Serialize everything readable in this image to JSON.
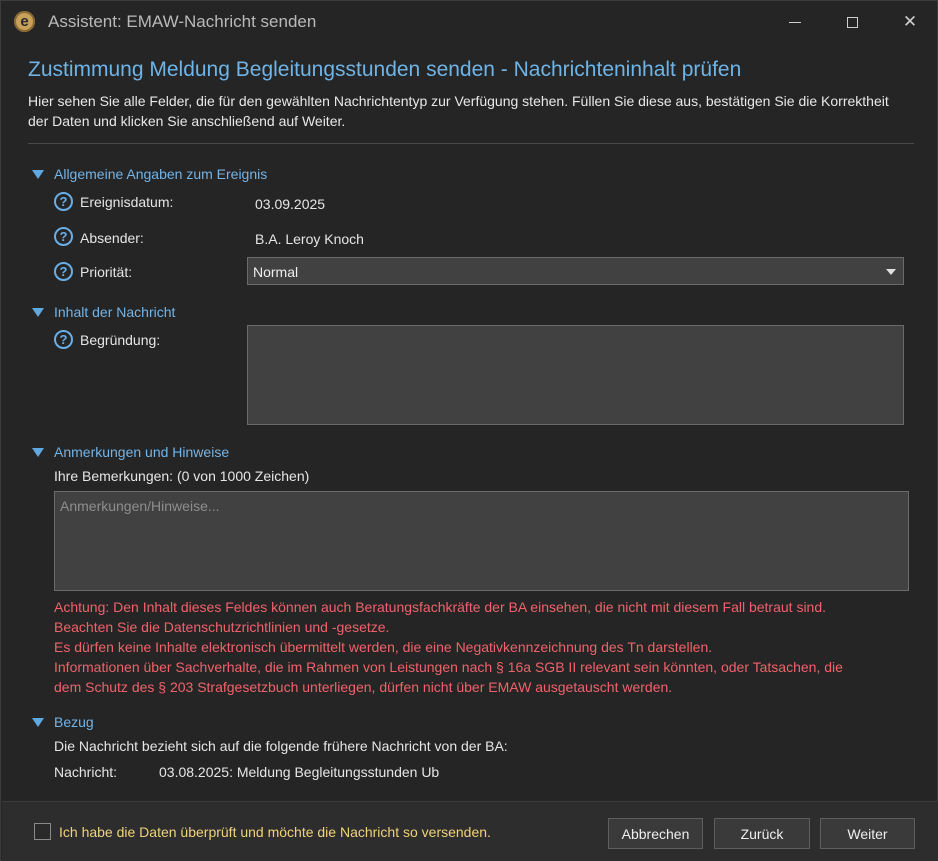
{
  "window": {
    "app_icon_letter": "e",
    "title": "Assistent: EMAW-Nachricht senden",
    "controls": {
      "minimize": "minimize",
      "maximize": "maximize",
      "close": "✕"
    }
  },
  "heading": "Zustimmung Meldung Begleitungsstunden senden - Nachrichteninhalt prüfen",
  "intro": "Hier sehen Sie alle Felder, die für den gewählten Nachrichtentyp zur Verfügung stehen. Füllen Sie diese aus, bestätigen Sie die Korrektheit der Daten und klicken Sie anschließend auf Weiter.",
  "sections": {
    "general": {
      "label": "Allgemeine Angaben zum Ereignis",
      "fields": {
        "date": {
          "label": "Ereignisdatum:",
          "value": "03.09.2025"
        },
        "sender": {
          "label": "Absender:",
          "value": "B.A. Leroy Knoch"
        },
        "priority": {
          "label": "Priorität:",
          "value": "Normal"
        }
      }
    },
    "content": {
      "label": "Inhalt der Nachricht",
      "fields": {
        "reason": {
          "label": "Begründung:",
          "value": ""
        }
      }
    },
    "notes": {
      "label": "Anmerkungen und Hinweise",
      "remarks_label": "Ihre Bemerkungen: (0 von 1000 Zeichen)",
      "placeholder": "Anmerkungen/Hinweise...",
      "warnings": [
        "Achtung: Den Inhalt dieses Feldes können auch Beratungsfachkräfte der BA einsehen, die nicht mit diesem Fall betraut sind.",
        "Beachten Sie die Datenschutzrichtlinien und -gesetze.",
        "Es dürfen keine Inhalte elektronisch übermittelt werden, die eine Negativkennzeichnung des Tn darstellen.",
        "Informationen über Sachverhalte, die im Rahmen von Leistungen nach § 16a SGB II relevant sein könnten, oder Tatsachen, die",
        "dem Schutz des § 203 Strafgesetzbuch unterliegen, dürfen nicht über EMAW ausgetauscht werden."
      ]
    },
    "reference": {
      "label": "Bezug",
      "text": "Die Nachricht bezieht sich auf die folgende frühere Nachricht von der BA:",
      "message_label": "Nachricht:",
      "message_value": "03.08.2025: Meldung Begleitungsstunden Ub"
    }
  },
  "footer": {
    "confirm_label": "Ich habe die Daten überprüft und möchte die Nachricht so versenden.",
    "confirm_checked": false,
    "cancel": "Abbrechen",
    "back": "Zurück",
    "next": "Weiter"
  },
  "icons": {
    "help": "?"
  },
  "colors": {
    "heading": "#6eb4e6",
    "section": "#74b4e6",
    "warning": "#f0626a",
    "confirm_text": "#f0d27a",
    "background": "#252526"
  }
}
